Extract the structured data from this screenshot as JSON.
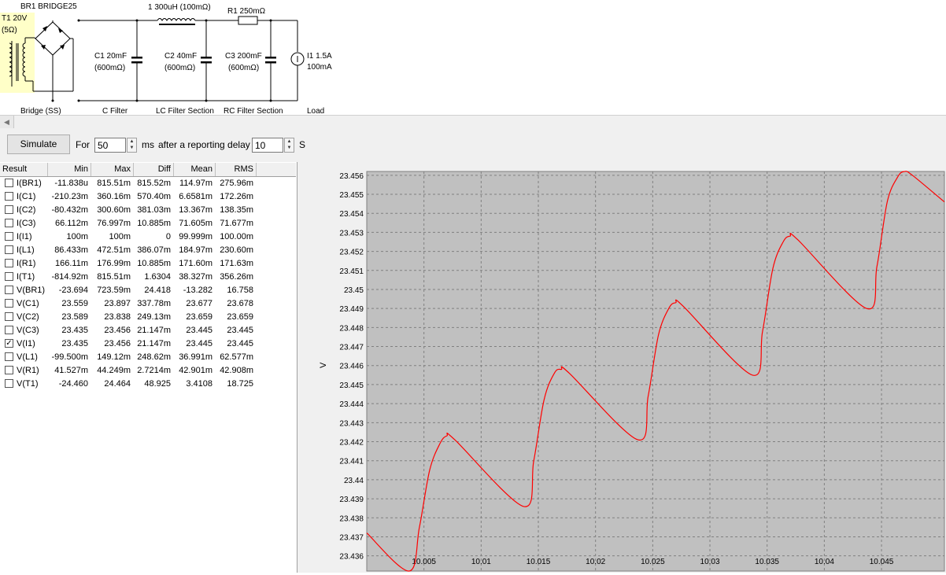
{
  "schematic": {
    "bridge_label": "BR1 BRIDGE25",
    "t1_line1": "T1 20V",
    "t1_line2": "(5Ω)",
    "l1_label": "1 300uH (100mΩ)",
    "r1_label": "R1 250mΩ",
    "c1_line1": "C1 20mF",
    "c1_line2": "(600mΩ)",
    "c2_line1": "C2 40mF",
    "c2_line2": "(600mΩ)",
    "c3_line1": "C3 200mF",
    "c3_line2": "(600mΩ)",
    "i1_line1": "I1 1.5A",
    "i1_line2": "100mA",
    "sections": [
      "Bridge (SS)",
      "C Filter",
      "LC Filter Section",
      "RC Filter Section",
      "Load"
    ]
  },
  "toolbar": {
    "simulate_label": "Simulate",
    "for_label": "For",
    "duration_value": "50",
    "duration_unit": "ms",
    "delay_label": "after a reporting delay of",
    "delay_value": "10",
    "delay_unit": "S"
  },
  "results": {
    "columns": [
      "Result",
      "Min",
      "Max",
      "Diff",
      "Mean",
      "RMS"
    ],
    "rows": [
      {
        "name": "I(BR1)",
        "min": "-11.838u",
        "max": "815.51m",
        "diff": "815.52m",
        "mean": "114.97m",
        "rms": "275.96m",
        "checked": false
      },
      {
        "name": "I(C1)",
        "min": "-210.23m",
        "max": "360.16m",
        "diff": "570.40m",
        "mean": "6.6581m",
        "rms": "172.26m",
        "checked": false
      },
      {
        "name": "I(C2)",
        "min": "-80.432m",
        "max": "300.60m",
        "diff": "381.03m",
        "mean": "13.367m",
        "rms": "138.35m",
        "checked": false
      },
      {
        "name": "I(C3)",
        "min": "66.112m",
        "max": "76.997m",
        "diff": "10.885m",
        "mean": "71.605m",
        "rms": "71.677m",
        "checked": false
      },
      {
        "name": "I(I1)",
        "min": "100m",
        "max": "100m",
        "diff": "0",
        "mean": "99.999m",
        "rms": "100.00m",
        "checked": false
      },
      {
        "name": "I(L1)",
        "min": "86.433m",
        "max": "472.51m",
        "diff": "386.07m",
        "mean": "184.97m",
        "rms": "230.60m",
        "checked": false
      },
      {
        "name": "I(R1)",
        "min": "166.11m",
        "max": "176.99m",
        "diff": "10.885m",
        "mean": "171.60m",
        "rms": "171.63m",
        "checked": false
      },
      {
        "name": "I(T1)",
        "min": "-814.92m",
        "max": "815.51m",
        "diff": "1.6304",
        "mean": "38.327m",
        "rms": "356.26m",
        "checked": false
      },
      {
        "name": "V(BR1)",
        "min": "-23.694",
        "max": "723.59m",
        "diff": "24.418",
        "mean": "-13.282",
        "rms": "16.758",
        "checked": false
      },
      {
        "name": "V(C1)",
        "min": "23.559",
        "max": "23.897",
        "diff": "337.78m",
        "mean": "23.677",
        "rms": "23.678",
        "checked": false
      },
      {
        "name": "V(C2)",
        "min": "23.589",
        "max": "23.838",
        "diff": "249.13m",
        "mean": "23.659",
        "rms": "23.659",
        "checked": false
      },
      {
        "name": "V(C3)",
        "min": "23.435",
        "max": "23.456",
        "diff": "21.147m",
        "mean": "23.445",
        "rms": "23.445",
        "checked": false
      },
      {
        "name": "V(I1)",
        "min": "23.435",
        "max": "23.456",
        "diff": "21.147m",
        "mean": "23.445",
        "rms": "23.445",
        "checked": true
      },
      {
        "name": "V(L1)",
        "min": "-99.500m",
        "max": "149.12m",
        "diff": "248.62m",
        "mean": "36.991m",
        "rms": "62.577m",
        "checked": false
      },
      {
        "name": "V(R1)",
        "min": "41.527m",
        "max": "44.249m",
        "diff": "2.7214m",
        "mean": "42.901m",
        "rms": "42.908m",
        "checked": false
      },
      {
        "name": "V(T1)",
        "min": "-24.460",
        "max": "24.464",
        "diff": "48.925",
        "mean": "3.4108",
        "rms": "18.725",
        "checked": false
      }
    ]
  },
  "chart_data": {
    "type": "line",
    "ylabel": "V",
    "xlabel": "",
    "xlim": [
      10.0,
      10.0505
    ],
    "ylim": [
      23.4352,
      23.4562
    ],
    "x_ticks": [
      "10.005",
      "10.01",
      "10.015",
      "10.02",
      "10.025",
      "10.03",
      "10.035",
      "10.04",
      "10.045"
    ],
    "y_ticks": [
      "23.436",
      "23.437",
      "23.438",
      "23.439",
      "23.44",
      "23.441",
      "23.442",
      "23.443",
      "23.444",
      "23.445",
      "23.446",
      "23.447",
      "23.448",
      "23.449",
      "23.45",
      "23.451",
      "23.452",
      "23.453",
      "23.454",
      "23.455",
      "23.456"
    ],
    "series": [
      {
        "color": "#ff0000",
        "points": [
          [
            10.0,
            23.4372
          ],
          [
            10.0037,
            23.4352
          ],
          [
            10.0046,
            23.4375
          ],
          [
            10.0055,
            23.4405
          ],
          [
            10.0064,
            23.4419
          ],
          [
            10.007,
            23.4423
          ],
          [
            10.0077,
            23.4421
          ],
          [
            10.0137,
            23.4386
          ],
          [
            10.0146,
            23.441
          ],
          [
            10.0155,
            23.4442
          ],
          [
            10.0164,
            23.4456
          ],
          [
            10.017,
            23.4458
          ],
          [
            10.0177,
            23.4456
          ],
          [
            10.0237,
            23.4421
          ],
          [
            10.0246,
            23.4444
          ],
          [
            10.0255,
            23.4476
          ],
          [
            10.0264,
            23.449
          ],
          [
            10.027,
            23.4493
          ],
          [
            10.0277,
            23.4491
          ],
          [
            10.0337,
            23.4455
          ],
          [
            10.0346,
            23.4478
          ],
          [
            10.0355,
            23.4511
          ],
          [
            10.0364,
            23.4525
          ],
          [
            10.037,
            23.4528
          ],
          [
            10.0377,
            23.4526
          ],
          [
            10.0437,
            23.449
          ],
          [
            10.0446,
            23.4512
          ],
          [
            10.0455,
            23.4546
          ],
          [
            10.0464,
            23.4559
          ],
          [
            10.047,
            23.4562
          ],
          [
            10.0477,
            23.456
          ],
          [
            10.0505,
            23.4546
          ]
        ]
      }
    ],
    "grid": true,
    "background": "#c0c0c0"
  }
}
